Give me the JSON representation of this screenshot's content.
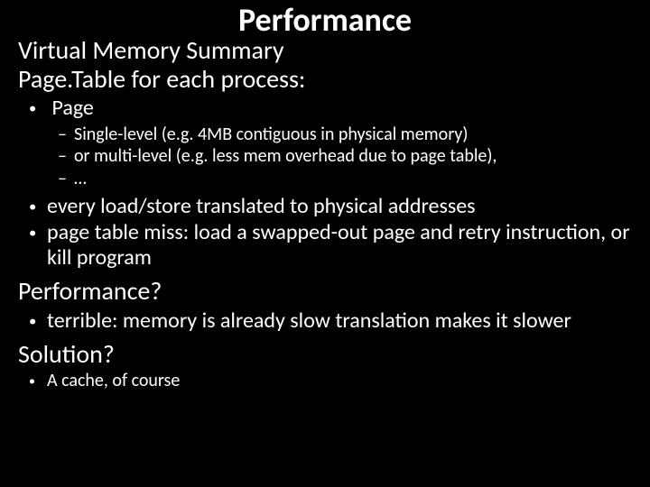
{
  "title": "Performance",
  "line1": "Virtual Memory Summary",
  "line2": "Page.Table for each process:",
  "bullets1": {
    "page": "Page",
    "sub": [
      "Single-level (e.g. 4MB contiguous in physical memory)",
      "or multi-level (e.g. less mem overhead due to page table),",
      "…"
    ],
    "b2": "every load/store translated to physical addresses",
    "b3": "page table miss: load a swapped-out page and retry instruction, or kill program"
  },
  "perfHeading": "Performance?",
  "perfBullets": {
    "b1": "terrible: memory is already slow translation makes it slower"
  },
  "solHeading": "Solution?",
  "solBullets": {
    "b1": "A cache, of course"
  }
}
